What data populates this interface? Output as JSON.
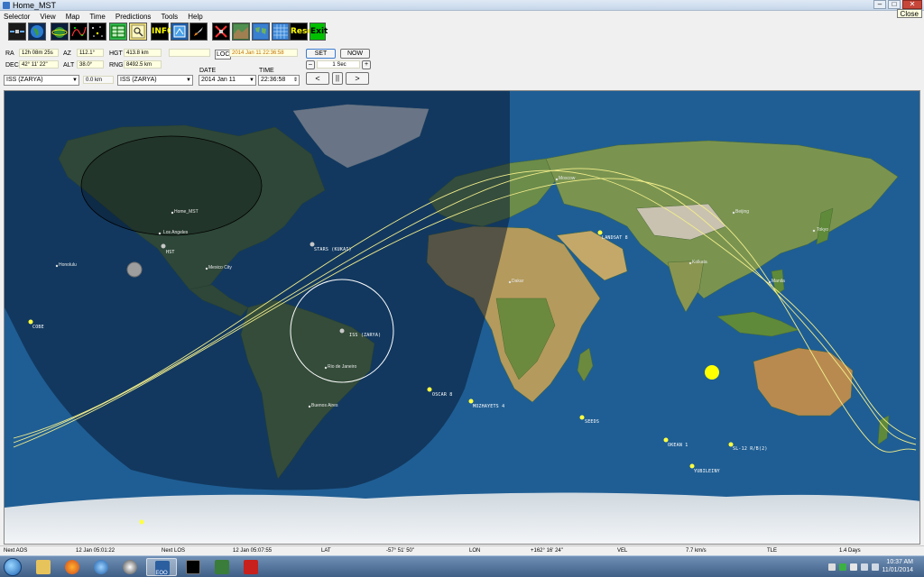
{
  "window": {
    "title": "Home_MST",
    "minimize": "–",
    "maximize": "□",
    "close": "✕",
    "close_tooltip": "Close"
  },
  "menu": [
    "Selector",
    "View",
    "Map",
    "Time",
    "Predictions",
    "Tools",
    "Help"
  ],
  "toolbar": {
    "info_label": "INFO",
    "reset_label": "Reset",
    "exit_label": "Exit"
  },
  "observer": {
    "ra_label": "RA",
    "ra_value": "12h 08m 25s",
    "dec_label": "DEC",
    "dec_value": "42° 11' 22\"",
    "az_label": "AZ",
    "az_value": "112.1°",
    "alt_label": "ALT",
    "alt_value": "38.0°",
    "hgt_label": "HGT",
    "hgt_value": "413.8 km",
    "rng_label": "RNG",
    "rng_value": "8492.5 km",
    "loc_label": "LOC",
    "loc_value": "2014 Jan 11   22:36:58",
    "sat_select_1": "ISS (ZARYA)",
    "distance_value": "0.0 km",
    "sat_select_2": "ISS (ZARYA)"
  },
  "time_controls": {
    "set_label": "SET",
    "now_label": "NOW",
    "minus_label": "–",
    "step_value": "1 Sec",
    "plus_label": "+",
    "prev_label": "<",
    "pause_label": "||",
    "next_label": ">",
    "date_heading": "DATE",
    "date_value": "2014  Jan  11",
    "time_heading": "TIME",
    "time_value": "22:36:58"
  },
  "map": {
    "satellites": [
      {
        "name": "ISS (ZARYA)",
        "color": "#c8c8c8"
      },
      {
        "name": "HST",
        "color": "#c8c8c8"
      },
      {
        "name": "STARS (KUKAI)",
        "color": "#c8c8c8"
      },
      {
        "name": "COBE",
        "color": "#ffff40"
      },
      {
        "name": "LANDSAT 8",
        "color": "#ffff40"
      },
      {
        "name": "OSCAR 8",
        "color": "#ffff40"
      },
      {
        "name": "MOZHAYETS 4",
        "color": "#ffff40"
      },
      {
        "name": "SEEDS",
        "color": "#ffff40"
      },
      {
        "name": "OKEAN 1",
        "color": "#ffff40"
      },
      {
        "name": "SL-12 R/B(2)",
        "color": "#ffff40"
      },
      {
        "name": "YUBILEINY",
        "color": "#ffff40"
      }
    ],
    "cities": [
      "Home_MST",
      "Los Angeles",
      "Mexico City",
      "Honolulu",
      "Moscow",
      "Beijing",
      "Tokyo",
      "Kolkata",
      "Dakar",
      "Manila",
      "Rio de Janeiro",
      "Buenos Aires"
    ],
    "colors": {
      "ocean": "#1e5f96",
      "night": "#0a1a30",
      "orbit": "#f5f08c",
      "sun": "#ffff00"
    }
  },
  "status": {
    "next_aos_label": "Next AOS",
    "next_aos_value": "12 Jan 05:01:22",
    "next_los_label": "Next LOS",
    "next_los_value": "12 Jan 05:07:55",
    "lat_label": "LAT",
    "lat_value": "-57° 51' 50\"",
    "lon_label": "LON",
    "lon_value": "+162° 16' 24\"",
    "vel_label": "VEL",
    "vel_value": "7.7 km/s",
    "tle_label": "TLE",
    "tle_value": "1.4 Days"
  },
  "taskbar": {
    "active_app_label": "EOO",
    "clock_time": "10:37 AM",
    "clock_date": "11/01/2014"
  }
}
